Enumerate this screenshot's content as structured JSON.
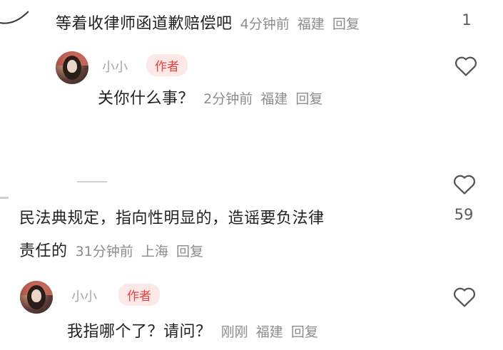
{
  "comments": [
    {
      "text": "等着收律师函道歉赔偿吧",
      "time": "4分钟前",
      "location": "福建",
      "reply": "回复",
      "likes": "1"
    },
    {
      "username": "小小",
      "badge": "作者",
      "text": "关你什么事？",
      "time": "2分钟前",
      "location": "福建",
      "reply": "回复"
    },
    {
      "text_line1": "民法典规定，指向性明显的，造谣要负法律",
      "text_line2": "责任的",
      "time": "31分钟前",
      "location": "上海",
      "reply": "回复",
      "likes": "59"
    },
    {
      "username": "小小",
      "badge": "作者",
      "text": "我指哪个了？请问？",
      "time": "刚刚",
      "location": "福建",
      "reply": "回复"
    }
  ],
  "icons": {
    "like": "heart-outline-icon"
  },
  "colors": {
    "badge_text": "#e8413d",
    "badge_bg": "#fde8e8",
    "meta": "#8c8c8c"
  }
}
